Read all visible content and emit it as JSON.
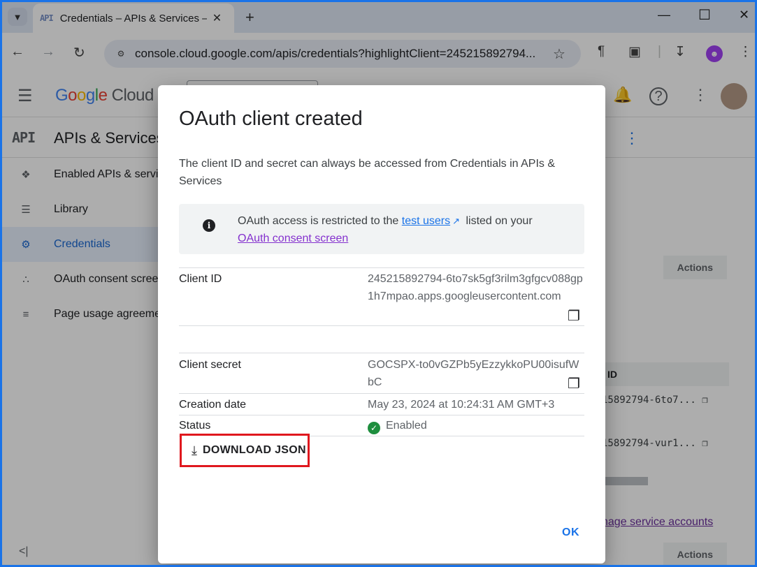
{
  "browser": {
    "tab_title": "Credentials – APIs & Services –",
    "tab_favicon": "API",
    "url": "console.cloud.google.com/apis/credentials?highlightClient=245215892794...",
    "icons": [
      "tab-list-icon",
      "close-icon",
      "new-tab-icon",
      "minimize-icon",
      "maximize-icon",
      "window-close-icon",
      "back-icon",
      "forward-icon",
      "reload-icon",
      "site-info-icon",
      "bookmark-star-icon",
      "reader-mode-icon",
      "extensions-icon",
      "download-icon",
      "profile-icon",
      "kebab-menu-icon"
    ]
  },
  "console": {
    "logo": {
      "g1": "G",
      "g2": "o",
      "g3": "o",
      "g4": "g",
      "g5": "l",
      "g6": "e",
      "cloud": " Cloud"
    },
    "api_logo": "API",
    "section_title": "APIs & Services",
    "sidebar": [
      {
        "label": "Enabled APIs & servi",
        "icon": "apis-diamond-icon"
      },
      {
        "label": "Library",
        "icon": "library-icon"
      },
      {
        "label": "Credentials",
        "icon": "key-icon",
        "active": true
      },
      {
        "label": "OAuth consent scree",
        "icon": "consent-icon"
      },
      {
        "label": "Page usage agreeme",
        "icon": "settings-list-icon"
      }
    ],
    "table_actions_1": "Actions",
    "table_id_header": "ID",
    "row1_id": "15892794-6to7...",
    "row2_id": "15892794-vur1...",
    "manage_link": "nage service accounts",
    "table_actions_2": "Actions"
  },
  "dialog": {
    "title": "OAuth client created",
    "description": "The client ID and secret can always be accessed from Credentials in APIs & Services",
    "info": {
      "pre": "OAuth access is restricted to the ",
      "link1": "test users",
      "mid": " listed on your ",
      "link2": "OAuth consent screen"
    },
    "client_id_label": "Client ID",
    "client_id_value": "245215892794-6to7sk5gf3rilm3gfgcv088gp1h7mpao.apps.googleusercontent.com",
    "client_secret_label": "Client secret",
    "client_secret_value": "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",
    "creation_date_label": "Creation date",
    "creation_date_value": "May 23, 2024 at 10:24:31 AM GMT+3",
    "status_label": "Status",
    "status_value": "Enabled",
    "download_label": "DOWNLOAD JSON",
    "ok_label": "OK"
  }
}
